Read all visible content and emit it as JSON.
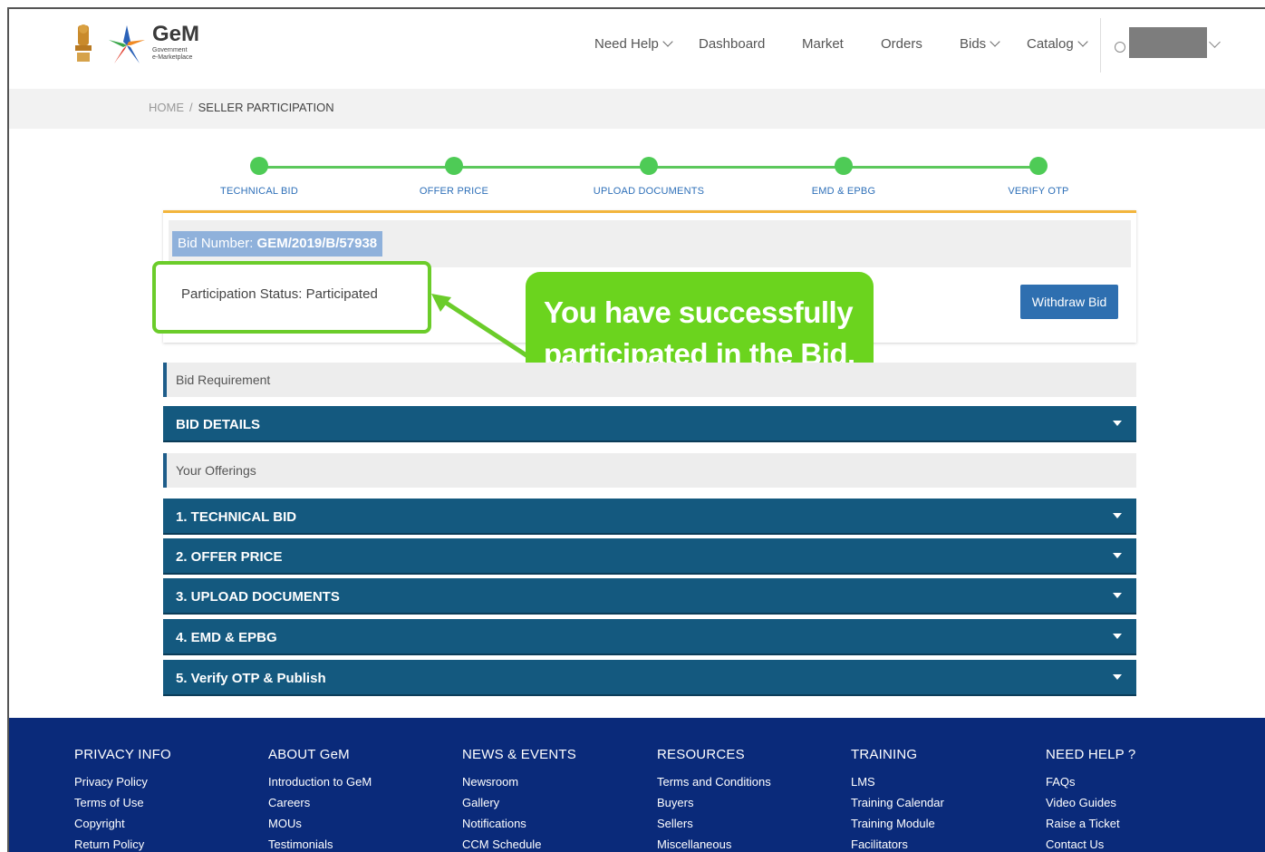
{
  "brand": {
    "name": "GeM",
    "sub1": "Government",
    "sub2": "e-Marketplace"
  },
  "nav": {
    "need_help": "Need Help",
    "dashboard": "Dashboard",
    "market": "Market",
    "orders": "Orders",
    "bids": "Bids",
    "catalog": "Catalog"
  },
  "breadcrumb": {
    "home": "HOME",
    "separator": "/",
    "current": "SELLER PARTICIPATION"
  },
  "steps": [
    "TECHNICAL BID",
    "OFFER PRICE",
    "UPLOAD DOCUMENTS",
    "EMD & EPBG",
    "VERIFY OTP"
  ],
  "bid": {
    "number_label": "Bid Number: ",
    "number_value": "GEM/2019/B/57938",
    "status": "Participation Status: Participated",
    "withdraw_label": "Withdraw Bid"
  },
  "callout": {
    "line1": "You have successfully",
    "line2": "participated in the Bid."
  },
  "sections": {
    "bid_requirement": "Bid Requirement",
    "bid_details": "BID DETAILS",
    "your_offerings": "Your Offerings",
    "technical_bid": "1. TECHNICAL BID",
    "offer_price": "2. OFFER PRICE",
    "upload_documents": "3. UPLOAD DOCUMENTS",
    "emd_epbg": "4. EMD & EPBG",
    "verify_otp": "5. Verify OTP & Publish"
  },
  "footer": {
    "columns": [
      {
        "title": "PRIVACY INFO",
        "links": [
          "Privacy Policy",
          "Terms of Use",
          "Copyright",
          "Return Policy"
        ]
      },
      {
        "title": "ABOUT GeM",
        "links": [
          "Introduction to GeM",
          "Careers",
          "MOUs",
          "Testimonials"
        ]
      },
      {
        "title": "NEWS & EVENTS",
        "links": [
          "Newsroom",
          "Gallery",
          "Notifications",
          "CCM Schedule"
        ]
      },
      {
        "title": "RESOURCES",
        "links": [
          "Terms and Conditions",
          "Buyers",
          "Sellers",
          "Miscellaneous"
        ]
      },
      {
        "title": "TRAINING",
        "links": [
          "LMS",
          "Training Calendar",
          "Training Module",
          "Facilitators"
        ]
      },
      {
        "title": "NEED HELP ?",
        "links": [
          "FAQs",
          "Video Guides",
          "Raise a Ticket",
          "Contact Us"
        ]
      }
    ]
  },
  "colors": {
    "step_green": "#4ecb56",
    "callout_green": "#6bd41e",
    "accordion_blue": "#14597f",
    "footer_navy": "#0a2a7a",
    "button_blue": "#2e6fb0",
    "accent_orange": "#f3b53c"
  }
}
